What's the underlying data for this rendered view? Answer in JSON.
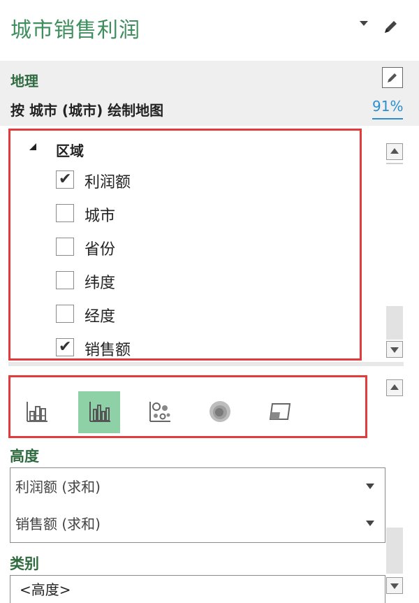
{
  "header": {
    "title": "城市销售利润",
    "icons": [
      "chevron-down-icon",
      "pencil-icon"
    ]
  },
  "geo": {
    "title": "地理",
    "subtitle": "按 城市 (城市) 绘制地图",
    "percent": "91%"
  },
  "fields": {
    "group": "区域",
    "items": [
      {
        "label": "利润额",
        "checked": true
      },
      {
        "label": "城市",
        "checked": false
      },
      {
        "label": "省份",
        "checked": false
      },
      {
        "label": "纬度",
        "checked": false
      },
      {
        "label": "经度",
        "checked": false
      },
      {
        "label": "销售额",
        "checked": true
      }
    ],
    "check_glyph": "✔"
  },
  "chart_types": {
    "items": [
      "stacked-column-icon",
      "clustered-column-icon",
      "bubble-icon",
      "heat-map-icon",
      "region-map-icon"
    ],
    "selected_index": 1,
    "selected_color": "#8ed1a7"
  },
  "height": {
    "label": "高度",
    "values": [
      "利润额 (求和)",
      "销售额 (求和)"
    ]
  },
  "category": {
    "label": "类别",
    "value": "<高度>"
  },
  "colors": {
    "accent_green": "#3e8e5e",
    "highlight_red": "#e23b3b",
    "link_blue": "#2a8fd0"
  }
}
